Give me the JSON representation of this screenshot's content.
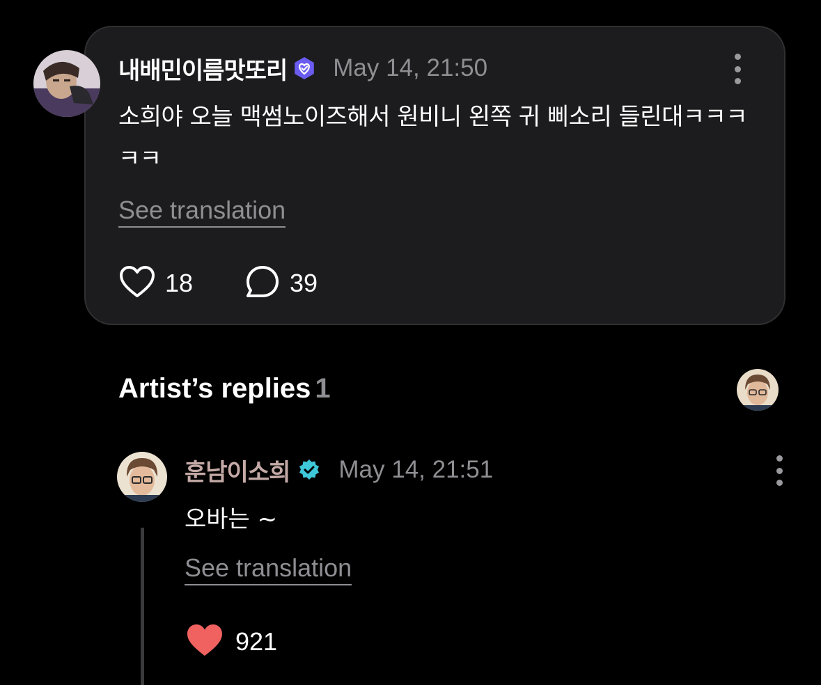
{
  "post": {
    "username": "내배민이름맛또리",
    "timestamp": "May 14, 21:50",
    "body": "소희야 오늘 맥썸노이즈해서 원비니 왼쪽 귀 삐소리 들린대ㅋㅋㅋㅋㅋ",
    "see_translation": "See translation",
    "likes": "18",
    "comments": "39",
    "icons": {
      "verified": "verified-heart-badge-icon",
      "more": "more-vertical-icon",
      "like": "heart-outline-icon",
      "comment": "comment-bubble-icon"
    },
    "colors": {
      "verified_badge": "#6b5cf0",
      "card_background": "#1c1c1e"
    }
  },
  "artist_replies": {
    "heading": "Artist’s replies",
    "count": "1"
  },
  "reply": {
    "username": "훈남이소희",
    "timestamp": "May 14, 21:51",
    "body": "오바는 ~",
    "see_translation": "See translation",
    "likes": "921",
    "icons": {
      "verified": "verified-check-badge-icon",
      "more": "more-vertical-icon",
      "like": "heart-filled-icon"
    },
    "colors": {
      "username": "#c4aaa6",
      "verified_badge": "#3ec8d9",
      "like_heart": "#f0625f"
    }
  }
}
